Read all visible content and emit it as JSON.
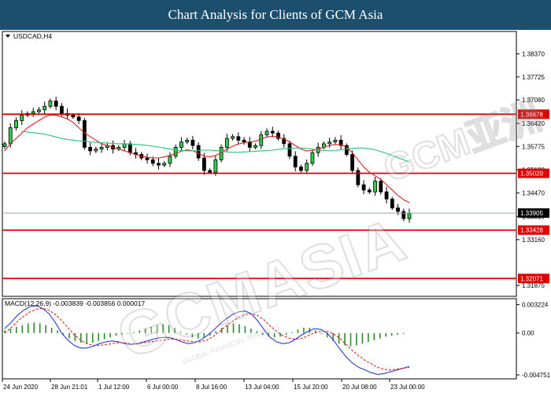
{
  "header": {
    "title": "Chart Analysis for Clients of GCM Asia"
  },
  "chart_data": [
    {
      "type": "candlestick",
      "symbol_label": "USDCAD,H4",
      "ylim": [
        1.3157,
        1.39
      ],
      "y_ticks": [
        "1.38370",
        "1.37725",
        "1.37080",
        "1.36420",
        "1.35775",
        "1.35120",
        "1.34470",
        "1.33810",
        "1.33160",
        "1.31875"
      ],
      "y_tick_values": [
        1.3837,
        1.37725,
        1.3708,
        1.3642,
        1.35775,
        1.3512,
        1.3447,
        1.3381,
        1.3316,
        1.31875
      ],
      "levels": [
        {
          "label": "1.36678",
          "value": 1.36678,
          "color": "#e00000"
        },
        {
          "label": "1.35020",
          "value": 1.3502,
          "color": "#e00000"
        },
        {
          "label": "1.33428",
          "value": 1.33428,
          "color": "#e00000"
        },
        {
          "label": "1.32071",
          "value": 1.32071,
          "color": "#e00000"
        }
      ],
      "current_price": {
        "label": "1.33905",
        "value": 1.33905,
        "color": "#9aa3ad"
      },
      "close": [
        1.3585,
        1.363,
        1.365,
        1.3665,
        1.367,
        1.3675,
        1.368,
        1.369,
        1.3705,
        1.369,
        1.367,
        1.3665,
        1.366,
        1.365,
        1.3575,
        1.3565,
        1.357,
        1.3575,
        1.358,
        1.357,
        1.3575,
        1.3585,
        1.356,
        1.3555,
        1.3545,
        1.354,
        1.353,
        1.3525,
        1.353,
        1.355,
        1.3575,
        1.359,
        1.3595,
        1.358,
        1.3545,
        1.351,
        1.3505,
        1.354,
        1.3575,
        1.36,
        1.3605,
        1.3595,
        1.359,
        1.3575,
        1.358,
        1.361,
        1.362,
        1.3615,
        1.36,
        1.3585,
        1.355,
        1.352,
        1.351,
        1.353,
        1.356,
        1.3575,
        1.3585,
        1.359,
        1.3595,
        1.358,
        1.3555,
        1.351,
        1.347,
        1.3455,
        1.345,
        1.348,
        1.345,
        1.343,
        1.3405,
        1.3395,
        1.3375,
        1.339
      ],
      "series": [
        {
          "name": "",
          "color": "#e02020",
          "values": [
            1.3565,
            1.3585,
            1.36,
            1.3615,
            1.363,
            1.364,
            1.365,
            1.366,
            1.3665,
            1.3665,
            1.366,
            1.3655,
            1.3645,
            1.363,
            1.3615,
            1.3605,
            1.3595,
            1.3585,
            1.358,
            1.3575,
            1.357,
            1.3565,
            1.356,
            1.3555,
            1.355,
            1.3547,
            1.3545,
            1.3545,
            1.3548,
            1.3552,
            1.3558,
            1.3564,
            1.3568,
            1.3565,
            1.3558,
            1.355,
            1.3548,
            1.3552,
            1.356,
            1.357,
            1.3578,
            1.3584,
            1.3588,
            1.359,
            1.3592,
            1.3598,
            1.3604,
            1.3606,
            1.3604,
            1.3598,
            1.359,
            1.358,
            1.357,
            1.3565,
            1.3566,
            1.357,
            1.3575,
            1.358,
            1.3583,
            1.3582,
            1.3575,
            1.356,
            1.354,
            1.352,
            1.3505,
            1.3495,
            1.3485,
            1.347,
            1.3455,
            1.344,
            1.3428,
            1.342
          ]
        },
        {
          "name": "",
          "color": "#22c47a",
          "values": [
            1.362,
            1.3618,
            1.3616,
            1.3614,
            1.3612,
            1.3608,
            1.3604,
            1.36,
            1.3597,
            1.3595,
            1.3593,
            1.3592,
            1.359,
            1.3589,
            1.3588,
            1.3587,
            1.3586,
            1.3585,
            1.3585,
            1.3584,
            1.3583,
            1.3582,
            1.358,
            1.3578,
            1.3576,
            1.3573,
            1.357,
            1.3568,
            1.3566,
            1.3565,
            1.3565,
            1.3566,
            1.3567,
            1.3567,
            1.3566,
            1.3564,
            1.3562,
            1.3561,
            1.3561,
            1.3562,
            1.3563,
            1.3564,
            1.3565,
            1.3566,
            1.3567,
            1.3569,
            1.3571,
            1.3572,
            1.3573,
            1.3573,
            1.3572,
            1.357,
            1.3568,
            1.3566,
            1.3565,
            1.3566,
            1.3568,
            1.357,
            1.3572,
            1.3573,
            1.3573,
            1.3571,
            1.3568,
            1.3563,
            1.3558,
            1.3552,
            1.3546,
            1.354,
            1.3533
          ]
        }
      ],
      "x_ticks": [
        "24 Jun 2020",
        "28 Jun 21:01",
        "1 Jul 12:00",
        "6 Jul 00:00",
        "8 Jul 16:00",
        "13 Jul 04:00",
        "15 Jul 20:00",
        "20 Jul 08:00",
        "23 Jul 00:00"
      ]
    },
    {
      "type": "macd",
      "label": "MACD(12,26,9) -0.003839 -0.003856 0.000017",
      "ylim": [
        -0.0052,
        0.0039
      ],
      "y_ticks": [
        "0.003224",
        "0.00",
        "-0.004751"
      ],
      "y_tick_values": [
        0.003224,
        0.0,
        -0.004751
      ],
      "histogram": [
        0.0003,
        0.0005,
        0.0007,
        0.0009,
        0.0011,
        0.0012,
        0.0011,
        0.0009,
        0.0006,
        0.0003,
        -0.0002,
        -0.0006,
        -0.0009,
        -0.0011,
        -0.0012,
        -0.0011,
        -0.0009,
        -0.0007,
        -0.0005,
        -0.0003,
        -0.0002,
        -0.0001,
        0.0001,
        0.0003,
        0.0005,
        0.0007,
        0.0009,
        0.001,
        0.0009,
        0.0006,
        0.0002,
        -0.0002,
        -0.0005,
        -0.0006,
        -0.0005,
        -0.0003,
        0.0002,
        0.0006,
        0.0009,
        0.0011,
        0.001,
        0.0008,
        0.0005,
        0.0002,
        -0.0002,
        -0.0004,
        -0.0005,
        -0.0004,
        -0.0002,
        0.0001,
        0.0004,
        0.0006,
        0.0006,
        0.0003,
        -0.0001,
        -0.0005,
        -0.0009,
        -0.0012,
        -0.0014,
        -0.0015,
        -0.0014,
        -0.0012,
        -0.001,
        -0.0008,
        -0.0006,
        -0.0004,
        -0.0003,
        -0.0002,
        -0.0001,
        0.0
      ],
      "series": [
        {
          "name": "",
          "color": "#2a3bd6",
          "values": [
            0.0005,
            0.0012,
            0.002,
            0.0026,
            0.003,
            0.0031,
            0.0028,
            0.0022,
            0.0012,
            0.0,
            -0.0008,
            -0.0014,
            -0.0017,
            -0.0017,
            -0.0015,
            -0.0012,
            -0.001,
            -0.0009,
            -0.001,
            -0.0012,
            -0.0013,
            -0.0012,
            -0.001,
            -0.0008,
            -0.0006,
            -0.0005,
            -0.0005,
            -0.0007,
            -0.001,
            -0.0012,
            -0.0011,
            -0.0008,
            -0.0003,
            0.0003,
            0.001,
            0.0016,
            0.0021,
            0.0024,
            0.0025,
            0.0022,
            0.0014,
            0.0004,
            -0.0005,
            -0.001,
            -0.0012,
            -0.0011,
            -0.0007,
            -0.0002,
            0.0002,
            0.0005,
            0.0004,
            0.0,
            -0.0008,
            -0.0018,
            -0.0027,
            -0.0034,
            -0.0039,
            -0.0042,
            -0.0045,
            -0.0047,
            -0.0046,
            -0.0044,
            -0.0042,
            -0.004,
            -0.0038
          ]
        },
        {
          "name": "",
          "color": "#e02020",
          "values": [
            0.0,
            0.0006,
            0.0013,
            0.0019,
            0.0024,
            0.0027,
            0.0028,
            0.0026,
            0.0021,
            0.0014,
            0.0006,
            -0.0002,
            -0.0008,
            -0.0012,
            -0.0014,
            -0.0014,
            -0.0013,
            -0.0012,
            -0.0011,
            -0.0011,
            -0.0012,
            -0.0012,
            -0.0011,
            -0.001,
            -0.0009,
            -0.0008,
            -0.0007,
            -0.0007,
            -0.0008,
            -0.0009,
            -0.001,
            -0.001,
            -0.0008,
            -0.0004,
            0.0002,
            0.0008,
            0.0013,
            0.0018,
            0.0021,
            0.0022,
            0.002,
            0.0015,
            0.0008,
            0.0002,
            -0.0003,
            -0.0006,
            -0.0007,
            -0.0006,
            -0.0003,
            0.0,
            0.0002,
            0.0002,
            -0.0001,
            -0.0006,
            -0.0013,
            -0.002,
            -0.0026,
            -0.0031,
            -0.0035,
            -0.0039,
            -0.0041,
            -0.0042,
            -0.0041,
            -0.004,
            -0.0039
          ]
        }
      ]
    }
  ],
  "watermark": {
    "text": "GCMASIA",
    "subtext": "GLOBAL FINANCIAL MARKETS",
    "side_text": "GCM亚洲"
  }
}
